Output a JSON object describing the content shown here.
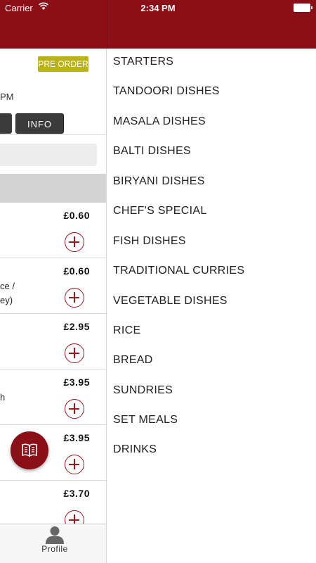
{
  "status_bar": {
    "carrier": "Carrier",
    "time": "2:34 PM"
  },
  "colors": {
    "brand_red": "#8b0f17",
    "preorder_badge": "#b9b21b",
    "dark_button": "#3b3b3b"
  },
  "left_panel": {
    "preorder_label": "PRE ORDER",
    "time_fragment": "PM",
    "info_label": "INFO",
    "items": [
      {
        "price": "£0.60",
        "desc_lines": []
      },
      {
        "price": "£0.60",
        "desc_lines": [
          "ce /",
          "ey)"
        ]
      },
      {
        "price": "£2.95",
        "desc_lines": []
      },
      {
        "price": "£3.95",
        "desc_lines": [
          "h"
        ]
      },
      {
        "price": "£3.95",
        "desc_lines": []
      },
      {
        "price": "£3.70",
        "desc_lines": []
      }
    ]
  },
  "fab_icon": "menu-book-icon",
  "tab_bar": {
    "profile_label": "Profile",
    "profile_icon": "person-icon"
  },
  "menu": {
    "items": [
      "STARTERS",
      "TANDOORI DISHES",
      "MASALA DISHES",
      "BALTI DISHES",
      "BIRYANI DISHES",
      "CHEF'S SPECIAL",
      "FISH DISHES",
      "TRADITIONAL CURRIES",
      "VEGETABLE DISHES",
      "RICE",
      "BREAD",
      "SUNDRIES",
      "SET MEALS",
      "DRINKS"
    ]
  }
}
